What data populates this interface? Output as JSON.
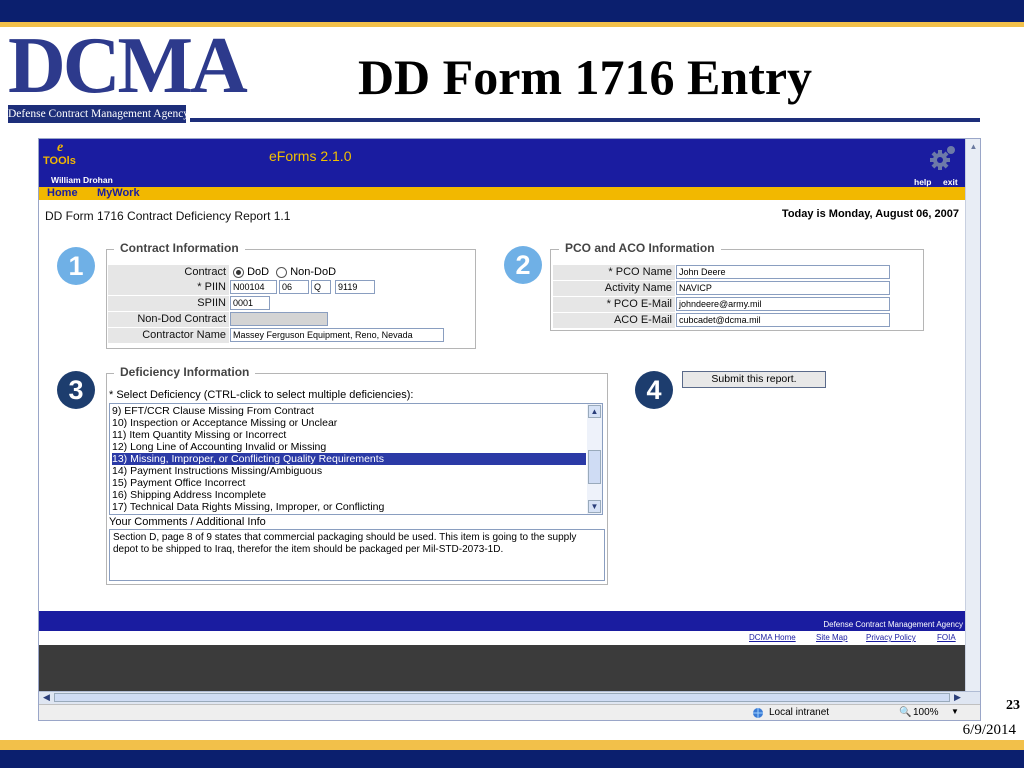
{
  "slide": {
    "title": "DD Form 1716 Entry",
    "logo_text": "DCMA",
    "logo_subtitle": "Defense Contract Management Agency",
    "page_number": "23",
    "date": "6/9/2014"
  },
  "app": {
    "logo_letter": "e",
    "logo_text": "TOOls",
    "name": "eForms 2.1.0",
    "user": "William Drohan",
    "help": "help",
    "exit": "exit",
    "nav": [
      "Home",
      "MyWork"
    ],
    "form_title": "DD Form 1716 Contract Deficiency Report 1.1",
    "today": "Today is Monday, August 06, 2007"
  },
  "steps": [
    "1",
    "2",
    "3",
    "4"
  ],
  "contract_info": {
    "legend": "Contract Information",
    "contract_label": "Contract",
    "radio_dod": "DoD",
    "radio_nondod": "Non-DoD",
    "selected": "DoD",
    "piin_label": "* PIIN",
    "piin": [
      "N00104",
      "06",
      "Q",
      "9119"
    ],
    "spiin_label": "SPIIN",
    "spiin": "0001",
    "nondod_label": "Non-Dod Contract",
    "nondod_value": "",
    "contractor_label": "Contractor Name",
    "contractor": "Massey Ferguson Equipment, Reno, Nevada"
  },
  "pco_info": {
    "legend": "PCO and ACO Information",
    "pco_name_label": "* PCO Name",
    "pco_name": "John Deere",
    "activity_label": "Activity Name",
    "activity": "NAVICP",
    "pco_email_label": "* PCO E-Mail",
    "pco_email": "johndeere@army.mil",
    "aco_email_label": "ACO E-Mail",
    "aco_email": "cubcadet@dcma.mil"
  },
  "deficiency": {
    "legend": "Deficiency Information",
    "prompt": "* Select Deficiency (CTRL-click to select multiple deficiencies):",
    "options": [
      "9) EFT/CCR Clause Missing From Contract",
      "10) Inspection or Acceptance Missing or Unclear",
      "11) Item Quantity Missing or Incorrect",
      "12) Long Line of Accounting Invalid or Missing",
      "13) Missing, Improper, or Conflicting Quality Requirements",
      "14) Payment Instructions Missing/Ambiguous",
      "15) Payment Office Incorrect",
      "16) Shipping Address Incomplete",
      "17) Technical Data Rights Missing, Improper, or Conflicting"
    ],
    "selected_index": 4,
    "comments_label": "Your Comments / Additional Info",
    "comments": "Section D, page 8 of 9 states that commercial packaging should be used.  This item is going to the supply depot to be shipped to Iraq, therefor the item should be packaged per Mil-STD-2073-1D."
  },
  "submit_label": "Submit this report.",
  "footer": {
    "agency": "Defense Contract Management Agency",
    "links": [
      "DCMA Home",
      "Site Map",
      "Privacy Policy",
      "FOIA"
    ]
  },
  "statusbar": {
    "zone": "Local intranet",
    "zoom": "100%"
  },
  "colors": {
    "slide_navy": "#0b1f6e",
    "slide_gold": "#f2c04a",
    "app_blue": "#1a1ca0",
    "nav_gold": "#f2b800",
    "selection": "#2b3aa6"
  }
}
